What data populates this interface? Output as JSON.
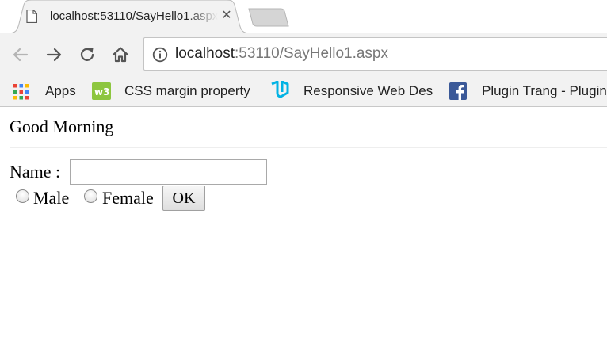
{
  "browser": {
    "tab": {
      "title": "localhost:53110/SayHello1.aspx",
      "favicon": "page-icon",
      "close": "✕"
    },
    "address": {
      "host": "localhost",
      "rest": ":53110/SayHello1.aspx"
    },
    "bookmarks": [
      {
        "label": "Apps",
        "icon": "apps-grid-icon"
      },
      {
        "label": "CSS margin property",
        "icon": "w3schools-icon"
      },
      {
        "label": "Responsive Web Des",
        "icon": "udacity-icon"
      },
      {
        "label": "Plugin Trang - Plugin",
        "icon": "facebook-icon"
      }
    ]
  },
  "page": {
    "heading": "Good Morning",
    "name_label": "Name :",
    "name_value": "",
    "gender_options": [
      {
        "label": "Male",
        "checked": false
      },
      {
        "label": "Female",
        "checked": false
      }
    ],
    "ok_label": "OK"
  }
}
